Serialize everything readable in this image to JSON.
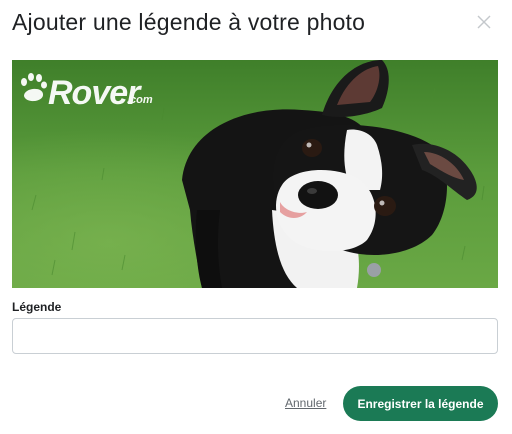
{
  "dialog": {
    "title": "Ajouter une légende à votre photo"
  },
  "photo": {
    "watermark": "Rover.com",
    "subject": "dog-photo"
  },
  "caption": {
    "label": "Légende",
    "value": "",
    "placeholder": ""
  },
  "actions": {
    "cancel_label": "Annuler",
    "save_label": "Enregistrer la légende"
  },
  "colors": {
    "primary": "#1b7a55",
    "text": "#1f2124",
    "muted": "#62686e",
    "border": "#c9cfd4"
  }
}
